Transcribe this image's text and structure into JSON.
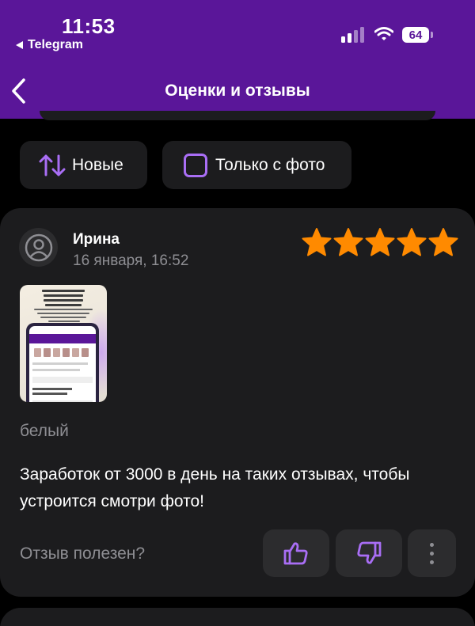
{
  "status_bar": {
    "time": "11:53",
    "back_app": "Telegram",
    "battery": "64"
  },
  "header": {
    "title": "Оценки и отзывы",
    "background_color": "#5a1699",
    "back_icon": "chevron-left-icon"
  },
  "filters": {
    "sort_label": "Новые",
    "sort_icon": "sort-arrows-icon",
    "photo_only_label": "Только с фото",
    "photo_only_checked": false,
    "accent_color": "#a96ef5"
  },
  "review": {
    "author": "Ирина",
    "date": "16 января, 16:52",
    "rating": 5,
    "rating_max": 5,
    "star_color": "#ff8a00",
    "variant": "белый",
    "text": "Заработок от 3000 в день на таких отзывах, чтобы устроится смотри фото!",
    "helpful_label": "Отзыв полезен?",
    "like_icon": "thumbs-up-icon",
    "dislike_icon": "thumbs-down-icon",
    "more_icon": "more-vertical-icon"
  }
}
